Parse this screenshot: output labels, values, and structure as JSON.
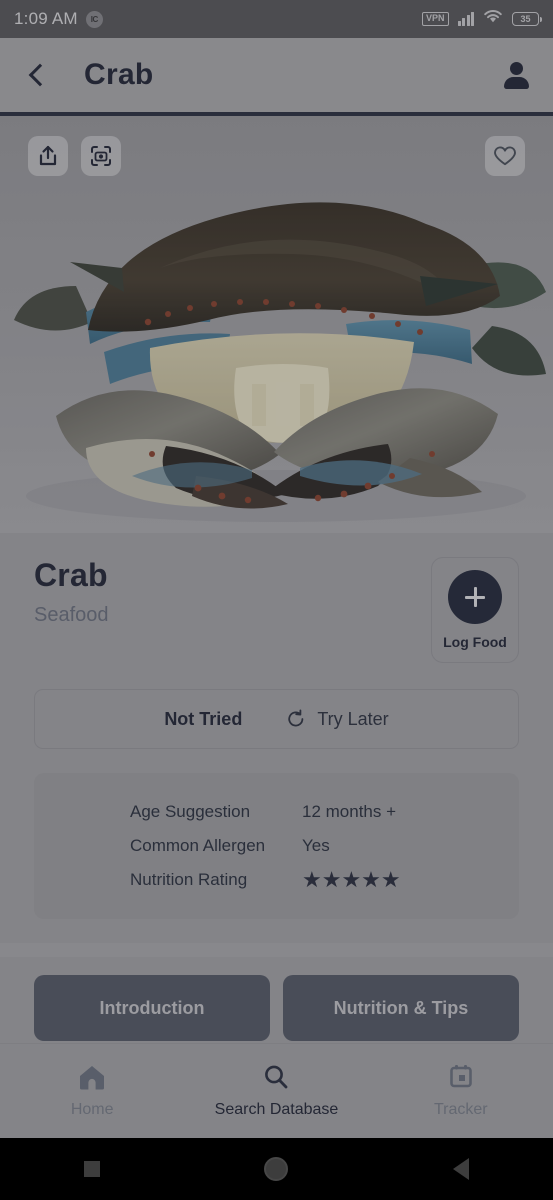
{
  "statusbar": {
    "time": "1:09 AM",
    "chip_label": "IC",
    "vpn_label": "VPN",
    "battery_level": "35",
    "icons": [
      "vpn-badge",
      "signal-bars-icon",
      "wifi-icon",
      "battery-icon"
    ]
  },
  "appbar": {
    "back_icon": "chevron-left-icon",
    "title": "Crab",
    "profile_icon": "person-icon"
  },
  "hero": {
    "image_alt": "Crab",
    "share_icon": "share-icon",
    "scan_icon": "camera-scan-icon",
    "favorite_icon": "heart-outline-icon"
  },
  "detail": {
    "title": "Crab",
    "category": "Seafood",
    "log_food_label": "Log Food",
    "log_food_icon": "plus-icon",
    "status": {
      "not_tried_label": "Not Tried",
      "try_later_label": "Try Later",
      "try_later_icon": "rotate-ccw-icon"
    },
    "info": [
      {
        "key": "Age Suggestion",
        "value": "12 months +"
      },
      {
        "key": "Common Allergen",
        "value": "Yes"
      },
      {
        "key": "Nutrition Rating",
        "value": "★★★★★",
        "stars": 5
      }
    ],
    "tabs": [
      {
        "label": "Introduction"
      },
      {
        "label": "Nutrition & Tips"
      }
    ]
  },
  "bottom_nav": [
    {
      "label": "Home",
      "icon": "home-icon",
      "active": false
    },
    {
      "label": "Search Database",
      "icon": "search-icon",
      "active": true
    },
    {
      "label": "Tracker",
      "icon": "calendar-icon",
      "active": false
    }
  ],
  "system_nav": {
    "recents_icon": "square-icon",
    "home_icon": "circle-icon",
    "back_icon": "triangle-back-icon"
  },
  "colors": {
    "accent_dark": "#242a3c",
    "tab_bg": "#565c69",
    "screen_bg": "#a8a8ab",
    "statusbar_bg": "#5b5b5e"
  }
}
